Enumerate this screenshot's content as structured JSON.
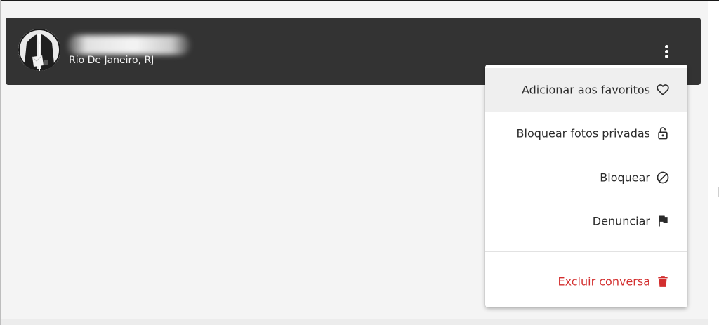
{
  "chat_header": {
    "location": "Rio De Janeiro, RJ",
    "avatar": "avatar-icon",
    "menu_icon": "more-vertical-icon"
  },
  "menu": {
    "items": [
      {
        "label": "Adicionar aos favoritos",
        "icon": "heart-icon"
      },
      {
        "label": "Bloquear fotos privadas",
        "icon": "lock-open-icon"
      },
      {
        "label": "Bloquear",
        "icon": "block-icon"
      },
      {
        "label": "Denunciar",
        "icon": "flag-icon"
      },
      {
        "label": "Excluir conversa",
        "icon": "trash-icon"
      }
    ]
  },
  "colors": {
    "header_bg": "#333333",
    "page_bg": "#f4f4f4",
    "danger": "#d32f2f",
    "menu_text": "#2b2b2b"
  }
}
